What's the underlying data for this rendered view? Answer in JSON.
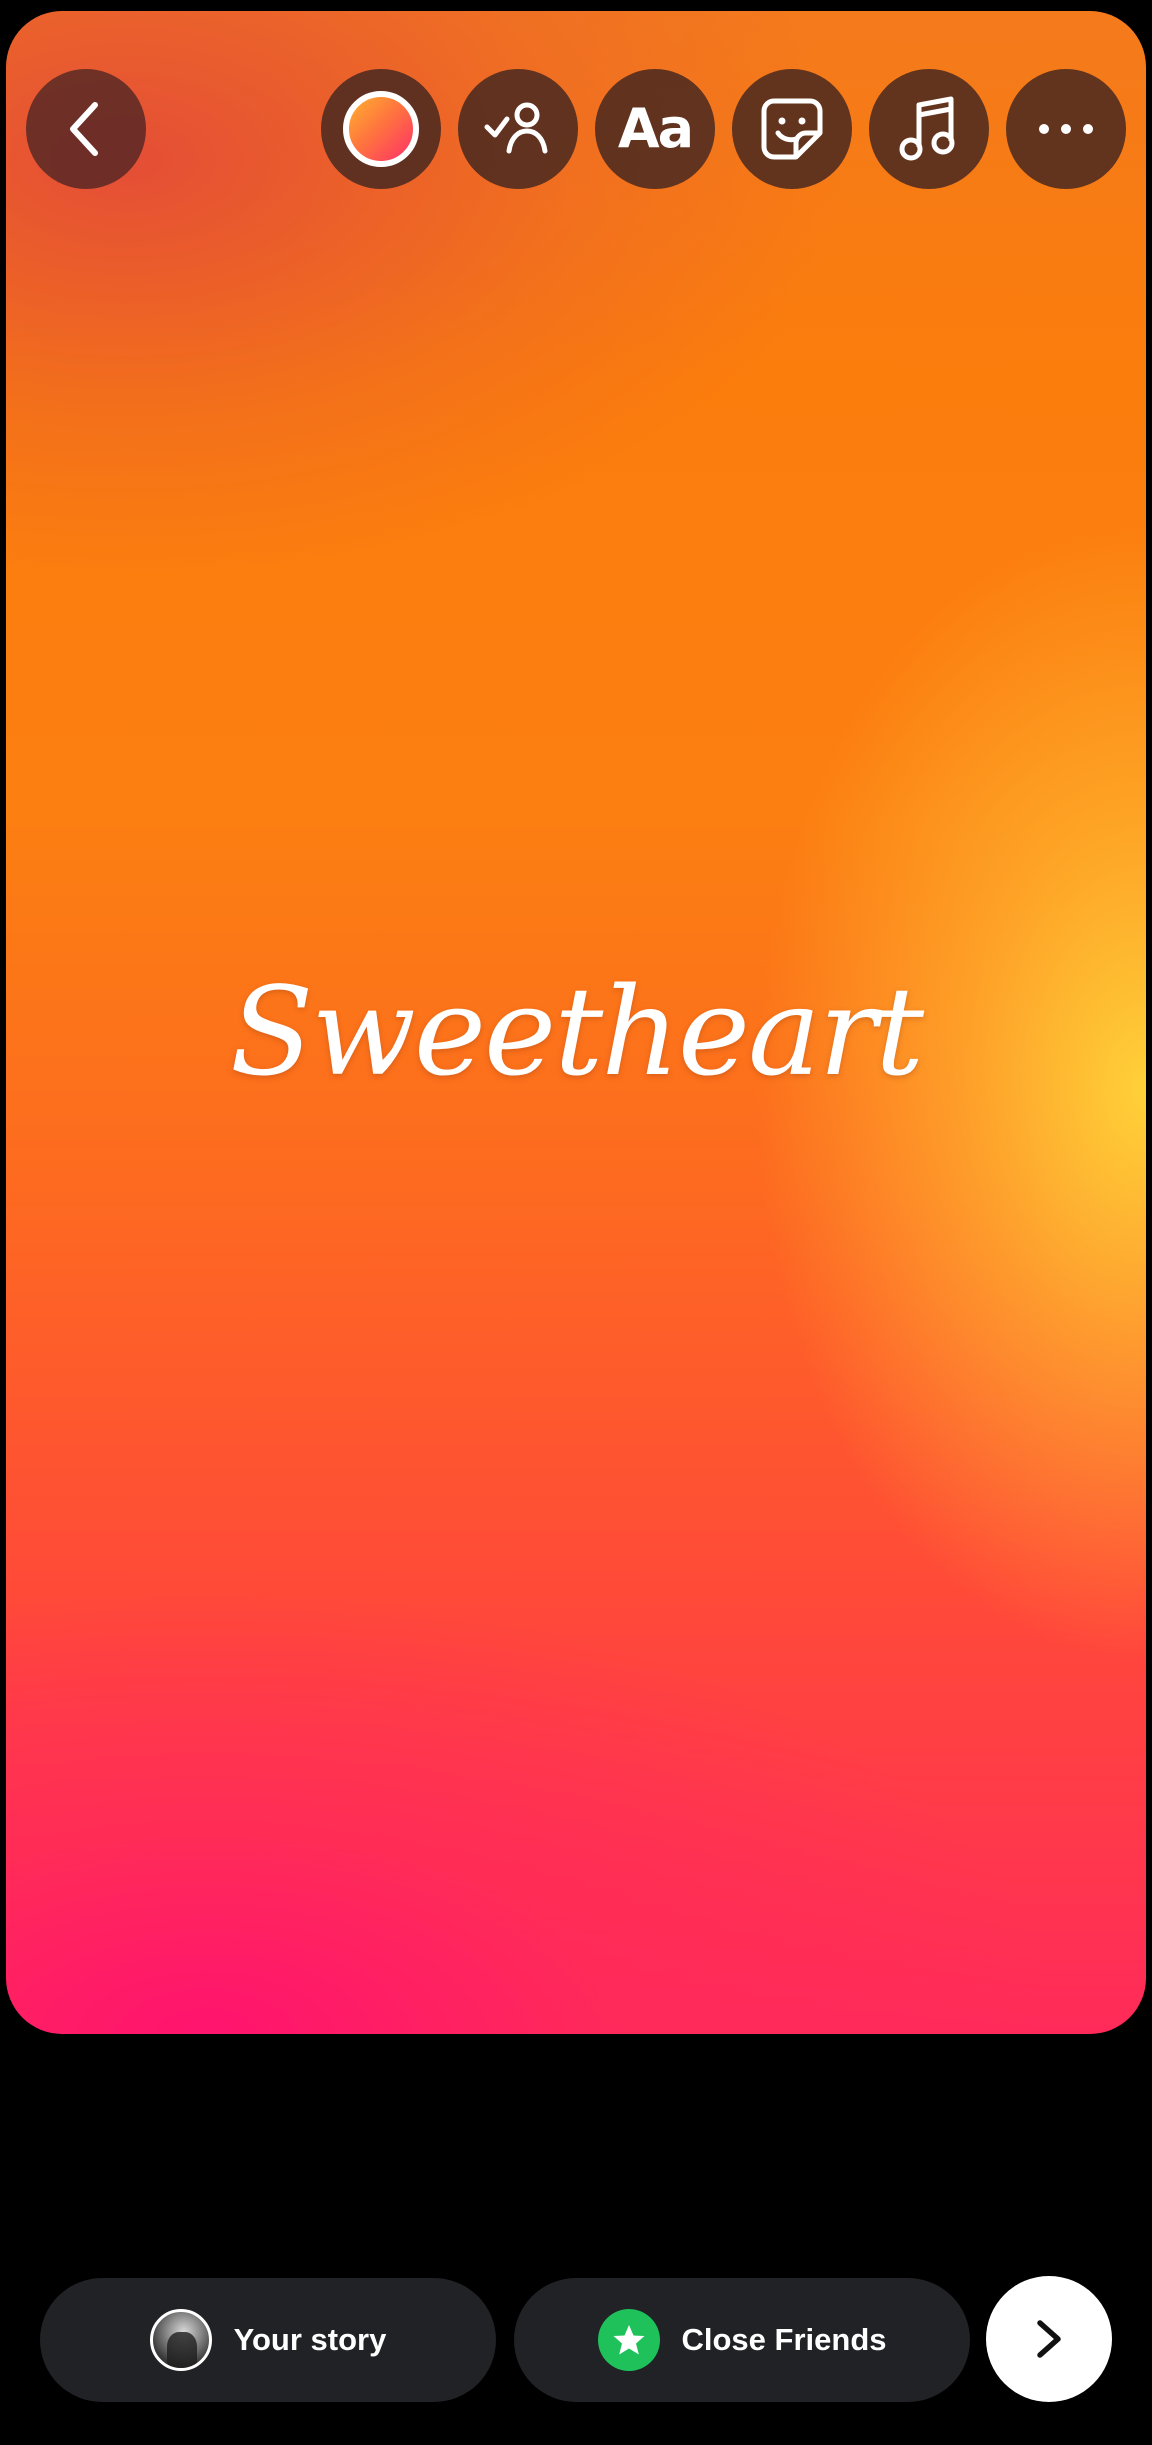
{
  "canvas": {
    "story_text": "Sweetheart",
    "background_colors": [
      "#f47a1c",
      "#fc7f12",
      "#ff4a38",
      "#ff1a64",
      "#ffd63a"
    ]
  },
  "toolbar": {
    "buttons": [
      {
        "name": "back-button",
        "icon": "chevron-left-icon"
      },
      {
        "name": "background-color-button",
        "icon": "color-swatch-icon"
      },
      {
        "name": "mention-button",
        "icon": "person-check-icon"
      },
      {
        "name": "text-button",
        "icon": "text-icon",
        "label": "Aa"
      },
      {
        "name": "sticker-button",
        "icon": "sticker-icon"
      },
      {
        "name": "music-button",
        "icon": "music-note-icon"
      },
      {
        "name": "more-button",
        "icon": "more-horizontal-icon"
      }
    ]
  },
  "share": {
    "your_story_label": "Your story",
    "close_friends_label": "Close Friends",
    "close_friends_color": "#1fc15b",
    "next_icon": "chevron-right-icon"
  }
}
